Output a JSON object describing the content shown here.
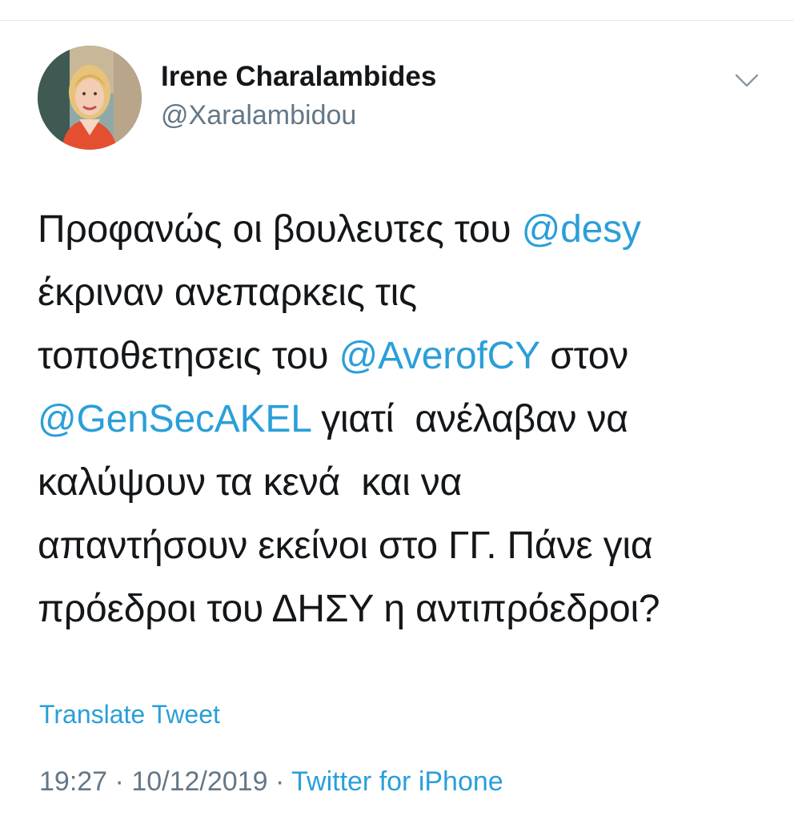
{
  "author": {
    "display_name": "Irene Charalambides",
    "handle": "@Xaralambidou"
  },
  "tweet": {
    "lines": [
      [
        {
          "text": "Προφανώς οι βουλευτες του ",
          "type": "text"
        },
        {
          "text": "@desy",
          "type": "mention"
        }
      ],
      [
        {
          "text": "έκριναν ανεπαρκεις τις",
          "type": "text"
        }
      ],
      [
        {
          "text": "τοποθετησεις του ",
          "type": "text"
        },
        {
          "text": "@AverofCY",
          "type": "mention"
        },
        {
          "text": " στον",
          "type": "text"
        }
      ],
      [
        {
          "text": "@GenSecAKEL",
          "type": "mention"
        },
        {
          "text": " γιατί  ανέλαβαν να",
          "type": "text"
        }
      ],
      [
        {
          "text": "καλύψουν τα κενά  και να",
          "type": "text"
        }
      ],
      [
        {
          "text": "απαντήσουν εκείνοι στο ΓΓ. Πάνε για",
          "type": "text"
        }
      ],
      [
        {
          "text": "πρόεδροι του ΔΗΣΥ η αντιπρόεδροι?",
          "type": "text"
        }
      ]
    ],
    "translate_label": "Translate Tweet"
  },
  "meta": {
    "time": "19:27",
    "separator": "·",
    "date": "10/12/2019",
    "source": "Twitter for iPhone"
  },
  "icons": {
    "more_menu": "chevron-down-icon"
  },
  "colors": {
    "link": "#2a9fd9",
    "text": "#14171a",
    "secondary": "#657786"
  }
}
